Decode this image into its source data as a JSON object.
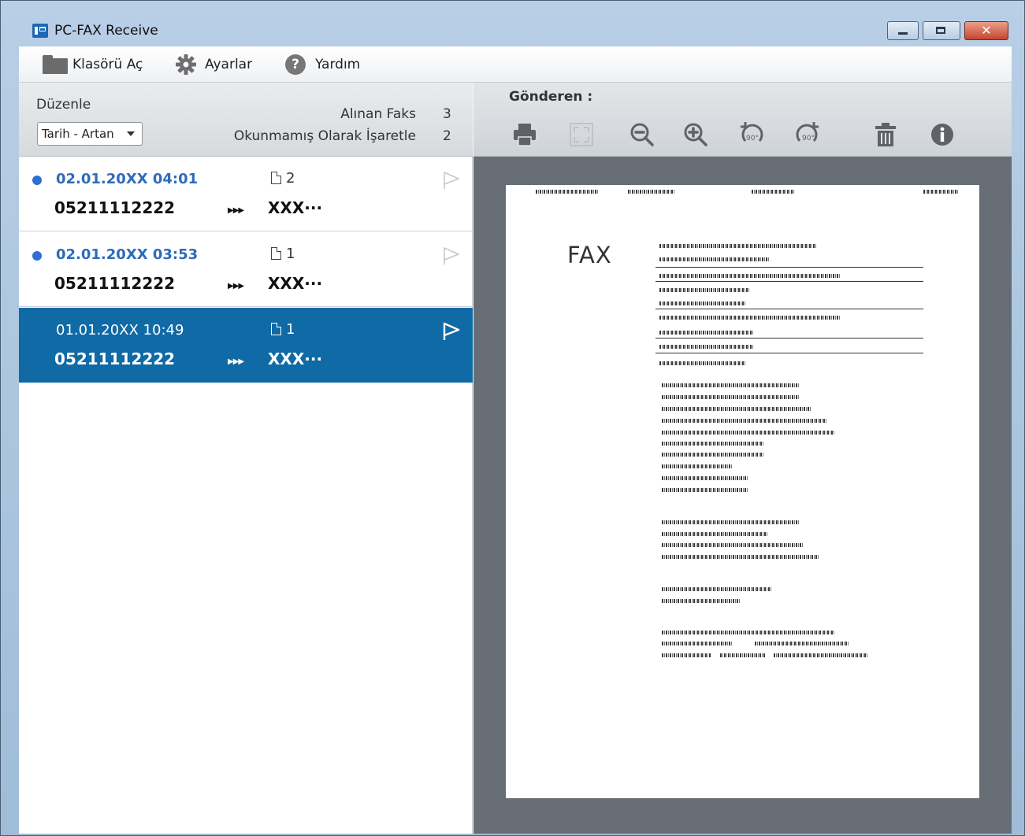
{
  "window": {
    "title": "PC-FAX Receive",
    "close_glyph": "✕"
  },
  "toolbar": {
    "open_folder": "Klasörü Aç",
    "settings": "Ayarlar",
    "help": "Yardım",
    "help_glyph": "?"
  },
  "left_header": {
    "sort_label": "Düzenle",
    "sort_value": "Tarih - Artan",
    "received_label": "Alınan Faks",
    "received_count": "3",
    "unread_label": "Okunmamış Olarak İşaretle",
    "unread_count": "2"
  },
  "fax_list": [
    {
      "date": "02.01.20XX 04:01",
      "pages": "2",
      "number": "05211112222",
      "name": "XXX···",
      "unread": true
    },
    {
      "date": "02.01.20XX 03:53",
      "pages": "1",
      "number": "05211112222",
      "name": "XXX···",
      "unread": true
    },
    {
      "date": "01.01.20XX 10:49",
      "pages": "1",
      "number": "05211112222",
      "name": "XXX···",
      "unread": false,
      "selected": true
    }
  ],
  "arrows_glyph": "▶▶▶",
  "viewer": {
    "sender_label": "Gönderen :",
    "fax_word": "FAX"
  },
  "colors": {
    "selected_row": "#0f6aa6",
    "unread_dot": "#2e6fd0",
    "viewer_bg": "#676d74"
  }
}
